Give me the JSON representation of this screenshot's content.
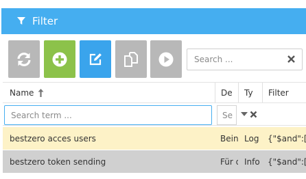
{
  "header": {
    "title": "Filter",
    "icon": "filter-icon"
  },
  "toolbar": {
    "buttons": [
      {
        "name": "refresh",
        "icon": "refresh-icon",
        "color": "#b8b8b8"
      },
      {
        "name": "add",
        "icon": "plus-circle-icon",
        "color": "#8cc24a"
      },
      {
        "name": "edit",
        "icon": "edit-icon",
        "color": "#3aa4ec"
      },
      {
        "name": "copy",
        "icon": "copy-icon",
        "color": "#b8b8b8"
      },
      {
        "name": "play",
        "icon": "play-icon",
        "color": "#b8b8b8"
      }
    ],
    "search_placeholder": "Search ..."
  },
  "table": {
    "columns": [
      {
        "label": "Name",
        "sort": "ascending"
      },
      {
        "label": "De"
      },
      {
        "label": "Ty"
      },
      {
        "label": "Filter"
      }
    ],
    "filter_row": {
      "name_placeholder": "Search term ...",
      "desc_placeholder": "Se"
    },
    "rows": [
      {
        "name": "bestzero acces users",
        "description": "Bein",
        "type": "Log",
        "filter": "{\"$and\":[{",
        "state": "highlighted"
      },
      {
        "name": "bestzero token sending",
        "description": "Für d",
        "type": "Info",
        "filter": "{\"$and\":[{",
        "state": "selected"
      }
    ]
  },
  "colors": {
    "accent": "#45aef0",
    "highlight_row": "#fdf2c7",
    "selected_row": "#d0d0d0"
  }
}
